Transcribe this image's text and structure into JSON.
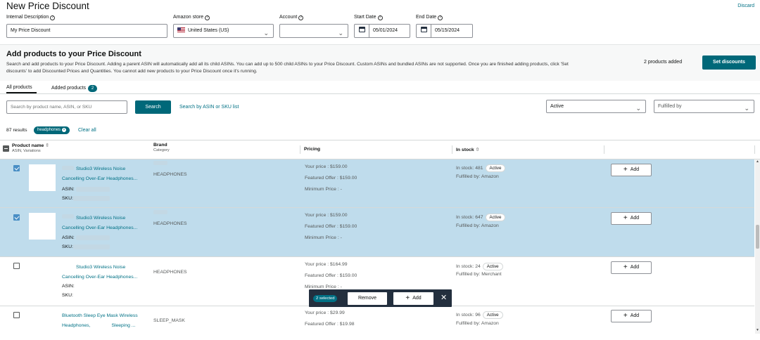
{
  "header": {
    "title": "New Price Discount",
    "discard": "Discard"
  },
  "form": {
    "internal_description": {
      "label": "Internal Description",
      "value": "My Price Discount"
    },
    "amazon_store": {
      "label": "Amazon store",
      "value": "United States (US)"
    },
    "account": {
      "label": "Account",
      "value": ""
    },
    "start_date": {
      "label": "Start Date",
      "value": "05/01/2024"
    },
    "end_date": {
      "label": "End Date",
      "value": "05/15/2024"
    }
  },
  "add_section": {
    "title": "Add products to your Price Discount",
    "description": "Search and add products to your Price Discount. Adding a parent ASIN will automatically add all its child ASINs. You can add up to 500 child ASINs to your Price Discount. Custom ASINs and bundled ASINs are not supported. Once you are finished adding products, click 'Set discounts' to add Discounted Prices and Quantities. You cannot add new products to your Price Discount once it's running.",
    "added_count": "2 products added",
    "set_discounts": "Set discounts"
  },
  "tabs": [
    {
      "label": "All products"
    },
    {
      "label": "Added products",
      "badge": "2"
    }
  ],
  "search": {
    "placeholder": "Search by product name, ASIN, or SKU",
    "button": "Search",
    "asin_link": "Search by ASIN or SKU list"
  },
  "filters": {
    "status": "Active",
    "fulfilled": "Fulfilled by"
  },
  "results": {
    "count": "87 results",
    "chip": "headphones",
    "clear": "Clear all"
  },
  "columns": {
    "product": "Product name",
    "product_sub": "ASIN, Variations",
    "brand": "Brand",
    "brand_sub": "Category",
    "pricing": "Pricing",
    "stock": "In stock"
  },
  "rows": [
    {
      "name1": "Studio3 Wireless Noise",
      "name2": "Cancelling Over-Ear Headphones...",
      "asin": "ASIN:",
      "sku": "SKU:",
      "brand": "HEADPHONES",
      "your_price": "Your price : $159.00",
      "featured": "Featured Offer : $159.00",
      "min_price": "Minimum Price : -",
      "in_stock": "In stock: 481",
      "status": "Active",
      "fulfilled": "Fulfilled by: Amazon",
      "add": "Add"
    },
    {
      "name1": "Studio3 Wireless Noise",
      "name2": "Cancelling Over-Ear Headphones...",
      "asin": "ASIN:",
      "sku": "SKU:",
      "brand": "HEADPHONES",
      "your_price": "Your price : $159.00",
      "featured": "Featured Offer : $159.00",
      "min_price": "Minimum Price : -",
      "in_stock": "In stock: 647",
      "status": "Active",
      "fulfilled": "Fulfilled by: Amazon",
      "add": "Add"
    },
    {
      "name1": "Studio3 Wireless Noise",
      "name2": "Cancelling Over-Ear Headphones...",
      "asin": "ASIN:",
      "sku": "SKU:",
      "brand": "HEADPHONES",
      "your_price": "Your price : $164.99",
      "featured": "Featured Offer : $159.00",
      "min_price": "Minimum Price : -",
      "in_stock": "In stock: 24",
      "status": "Active",
      "fulfilled": "Fulfilled by: Merchant",
      "add": "Add"
    },
    {
      "name1": "Bluetooth Sleep Eye Mask Wireless",
      "name2": "Headphones,",
      "name3": "Sleeping ...",
      "brand": "SLEEP_MASK",
      "your_price": "Your price : $29.99",
      "featured": "Featured Offer : $19.98",
      "in_stock": "In stock: 96",
      "status": "Active",
      "fulfilled": "Fulfilled by: Amazon",
      "add": "Add"
    }
  ],
  "action_bar": {
    "selected": "2 selected",
    "remove": "Remove",
    "add": "Add"
  },
  "colors": {
    "accent": "#006879",
    "link": "#007185",
    "selected_row": "#bfdcec",
    "action_bar": "#232f3e"
  }
}
